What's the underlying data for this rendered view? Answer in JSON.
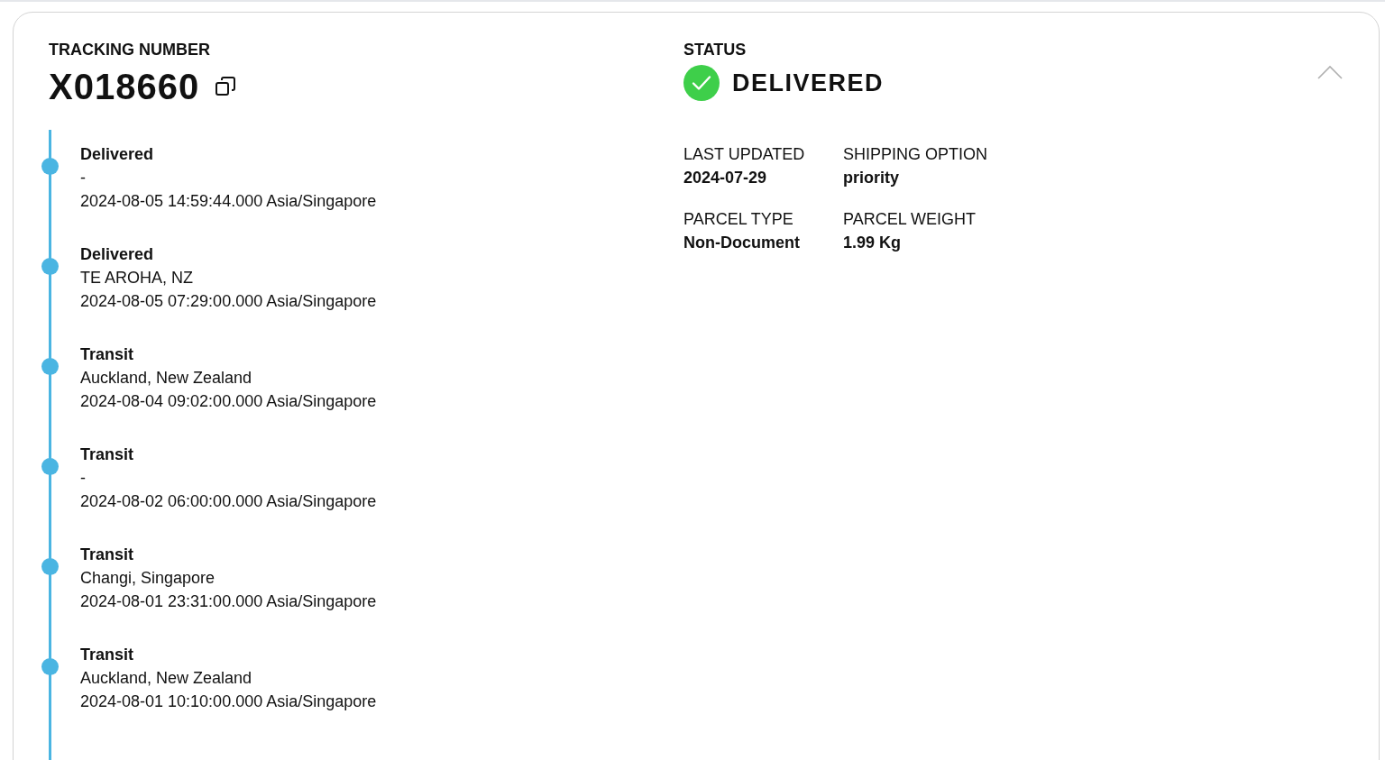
{
  "tracking": {
    "label": "TRACKING NUMBER",
    "number": "X018660"
  },
  "status": {
    "label": "STATUS",
    "value": "DELIVERED",
    "kind": "delivered"
  },
  "expanded": true,
  "details": [
    {
      "label": "LAST UPDATED",
      "value": "2024-07-29"
    },
    {
      "label": "SHIPPING OPTION",
      "value": "priority"
    },
    {
      "label": "PARCEL TYPE",
      "value": "Non-Document"
    },
    {
      "label": "PARCEL WEIGHT",
      "value": "1.99 Kg"
    }
  ],
  "events": [
    {
      "title": "Delivered",
      "location": "-",
      "time": "2024-08-05 14:59:44.000 Asia/Singapore"
    },
    {
      "title": "Delivered",
      "location": "TE AROHA, NZ",
      "time": "2024-08-05 07:29:00.000 Asia/Singapore"
    },
    {
      "title": "Transit",
      "location": "Auckland, New Zealand",
      "time": "2024-08-04 09:02:00.000 Asia/Singapore"
    },
    {
      "title": "Transit",
      "location": "-",
      "time": "2024-08-02 06:00:00.000 Asia/Singapore"
    },
    {
      "title": "Transit",
      "location": "Changi, Singapore",
      "time": "2024-08-01 23:31:00.000 Asia/Singapore"
    },
    {
      "title": "Transit",
      "location": "Auckland, New Zealand",
      "time": "2024-08-01 10:10:00.000 Asia/Singapore"
    }
  ]
}
